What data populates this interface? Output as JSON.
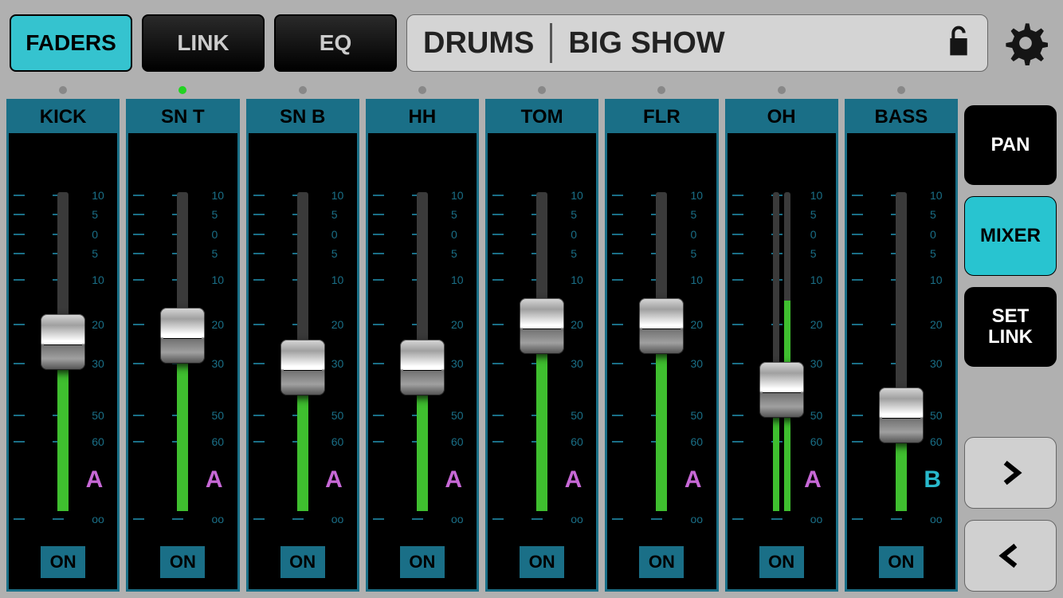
{
  "header": {
    "tabs": {
      "faders": "FADERS",
      "link": "LINK",
      "eq": "EQ"
    },
    "group_name": "DRUMS",
    "show_name": "BIG SHOW"
  },
  "scale_labels": [
    "10",
    "5",
    "0",
    "5",
    "10",
    "20",
    "30",
    "50",
    "60",
    "oo"
  ],
  "scale_positions": [
    0,
    6,
    12,
    18,
    26,
    40,
    52,
    68,
    76,
    100
  ],
  "channels": [
    {
      "name": "KICK",
      "group": "A",
      "fader_pct": 53,
      "stereo": false,
      "indicator": false,
      "on": "ON"
    },
    {
      "name": "SN T",
      "group": "A",
      "fader_pct": 55,
      "stereo": false,
      "indicator": true,
      "on": "ON"
    },
    {
      "name": "SN B",
      "group": "A",
      "fader_pct": 45,
      "stereo": false,
      "indicator": false,
      "on": "ON"
    },
    {
      "name": "HH",
      "group": "A",
      "fader_pct": 45,
      "stereo": false,
      "indicator": false,
      "on": "ON"
    },
    {
      "name": "TOM",
      "group": "A",
      "fader_pct": 58,
      "stereo": false,
      "indicator": false,
      "on": "ON"
    },
    {
      "name": "FLR",
      "group": "A",
      "fader_pct": 58,
      "stereo": false,
      "indicator": false,
      "on": "ON"
    },
    {
      "name": "OH",
      "group": "A",
      "fader_pct": 38,
      "stereo": true,
      "indicator": false,
      "on": "ON"
    },
    {
      "name": "BASS",
      "group": "B",
      "fader_pct": 30,
      "stereo": false,
      "indicator": false,
      "on": "ON"
    }
  ],
  "side": {
    "pan": "PAN",
    "mixer": "MIXER",
    "set_link": "SET\nLINK"
  }
}
